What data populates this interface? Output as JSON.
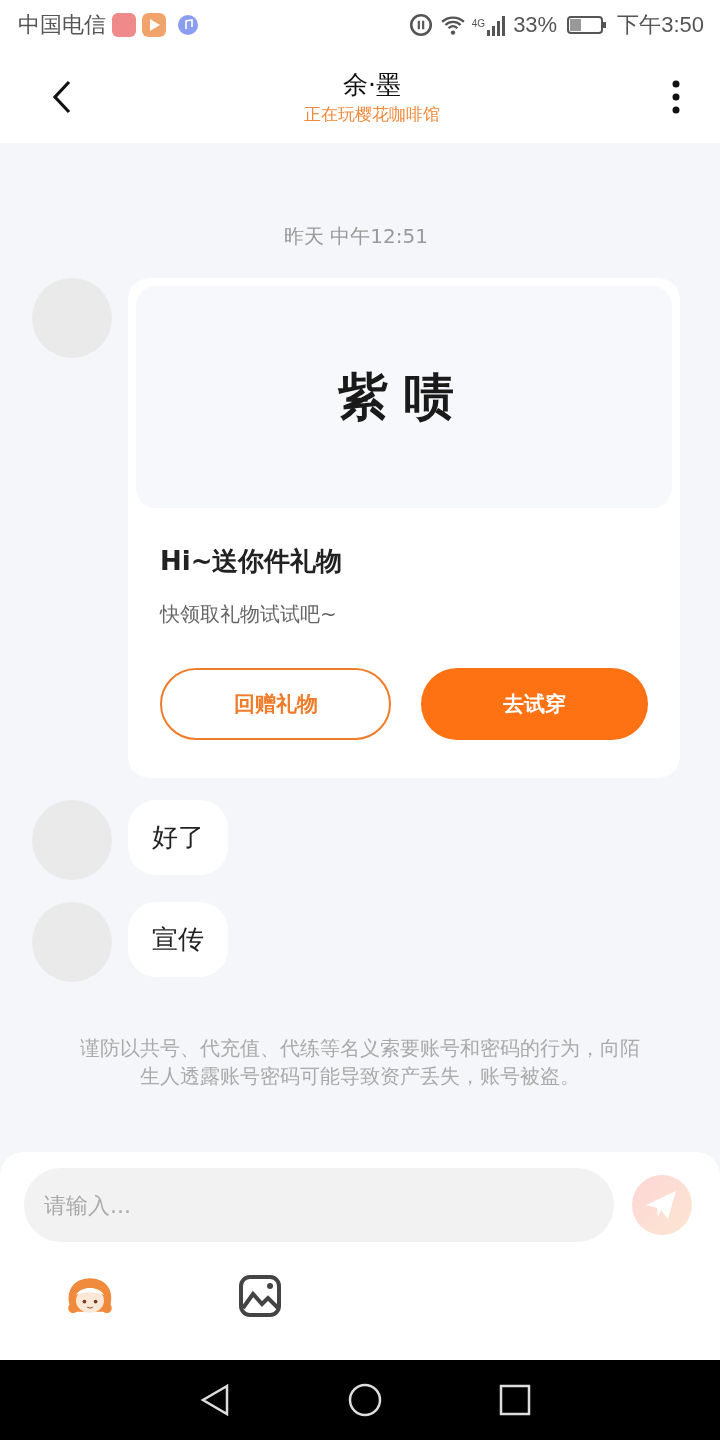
{
  "status_bar": {
    "carrier": "中国电信",
    "network": "4G",
    "battery": "33%",
    "time": "下午3:50"
  },
  "header": {
    "title": "余·墨",
    "subtitle": "正在玩樱花咖啡馆"
  },
  "timestamp": "昨天 中午12:51",
  "messages": [
    {
      "kind": "gift",
      "preview_text": "紫啧",
      "title": "Hi~送你件礼物",
      "body": "快领取礼物试试吧~",
      "buttons": [
        {
          "label": "回赠礼物",
          "kind": "outline"
        },
        {
          "label": "去试穿",
          "kind": "filled"
        }
      ]
    },
    {
      "kind": "text",
      "text": "好了"
    },
    {
      "kind": "text",
      "text": "宣传"
    }
  ],
  "notice": "谨防以共号、代充值、代练等名义索要账号和密码的行为，向陌生人透露账号密码可能导致资产丢失，账号被盗。",
  "input": {
    "placeholder": "请输入..."
  }
}
